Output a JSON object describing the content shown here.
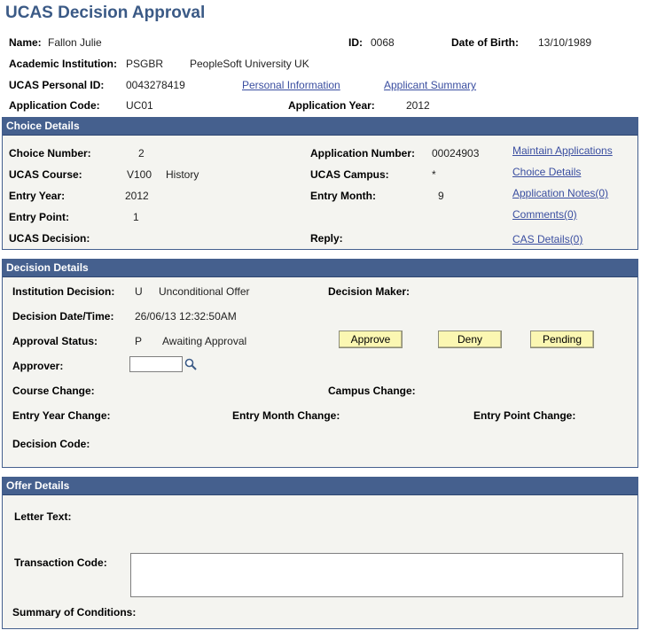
{
  "page": {
    "title": "UCAS Decision Approval"
  },
  "header": {
    "name_label": "Name:",
    "name_value": "Fallon Julie",
    "id_label": "ID:",
    "id_value": "0068",
    "dob_label": "Date of Birth:",
    "dob_value": "13/10/1989",
    "institution_label": "Academic Institution:",
    "institution_code": "PSGBR",
    "institution_name": "PeopleSoft University UK",
    "ucas_pid_label": "UCAS Personal ID:",
    "ucas_pid_value": "0043278419",
    "personal_info_link": "Personal Information",
    "applicant_summary_link": "Applicant Summary",
    "app_code_label": "Application Code:",
    "app_code_value": "UC01",
    "app_year_label": "Application Year:",
    "app_year_value": "2012"
  },
  "choice": {
    "heading": "Choice Details",
    "choice_number_label": "Choice Number:",
    "choice_number_value": "2",
    "ucas_course_label": "UCAS Course:",
    "ucas_course_code": "V100",
    "ucas_course_name": "History",
    "entry_year_label": "Entry Year:",
    "entry_year_value": "2012",
    "entry_point_label": "Entry Point:",
    "entry_point_value": "1",
    "ucas_decision_label": "UCAS Decision:",
    "app_number_label": "Application Number:",
    "app_number_value": "00024903",
    "ucas_campus_label": "UCAS Campus:",
    "ucas_campus_value": "*",
    "entry_month_label": "Entry Month:",
    "entry_month_value": "9",
    "reply_label": "Reply:",
    "links": {
      "maintain_applications": "Maintain Applications",
      "choice_details": "Choice Details",
      "application_notes": "Application Notes(0)",
      "comments": "Comments(0)",
      "cas_details": "CAS Details(0)"
    }
  },
  "decision": {
    "heading": "Decision Details",
    "institution_decision_label": "Institution Decision:",
    "institution_decision_code": "U",
    "institution_decision_text": "Unconditional Offer",
    "decision_maker_label": "Decision Maker:",
    "decision_datetime_label": "Decision Date/Time:",
    "decision_datetime_value": "26/06/13 12:32:50AM",
    "approval_status_label": "Approval Status:",
    "approval_status_code": "P",
    "approval_status_text": "Awaiting Approval",
    "approve_button": "Approve",
    "deny_button": "Deny",
    "pending_button": "Pending",
    "approver_label": "Approver:",
    "approver_value": "",
    "course_change_label": "Course Change:",
    "campus_change_label": "Campus Change:",
    "entry_year_change_label": "Entry Year Change:",
    "entry_month_change_label": "Entry Month Change:",
    "entry_point_change_label": "Entry Point Change:",
    "decision_code_label": "Decision Code:"
  },
  "offer": {
    "heading": "Offer Details",
    "letter_text_label": "Letter Text:",
    "transaction_code_label": "Transaction Code:",
    "transaction_code_value": "",
    "summary_conditions_label": "Summary of Conditions:"
  },
  "colors": {
    "section_header_bg": "#45608e",
    "title_color": "#3b5a86",
    "button_bg": "#fbf7b2",
    "link_color": "#3a4ea0"
  },
  "icons": {
    "lookup": "magnifier-icon"
  }
}
